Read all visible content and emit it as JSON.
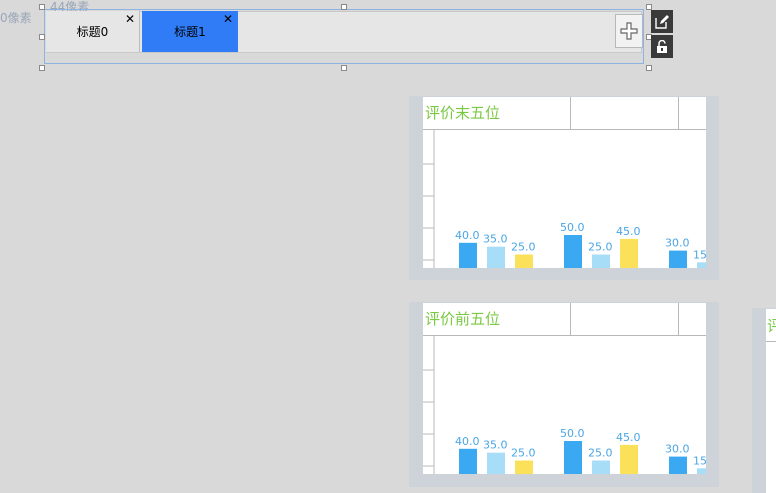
{
  "measure": {
    "left_label": "0像素",
    "top_label": "44像素"
  },
  "tabs": [
    {
      "label": "标题0",
      "close": "✕"
    },
    {
      "label": "标题1",
      "close": "✕"
    }
  ],
  "colors": {
    "bar_blue": "#3aa9f2",
    "bar_lightblue": "#a8ddf8",
    "bar_yellow": "#fbe05a",
    "title_green": "#7ac943"
  },
  "cards": [
    {
      "title": "评价末五位"
    },
    {
      "title": "评价前五位"
    },
    {
      "title": "评"
    }
  ],
  "chart_data": [
    {
      "type": "bar",
      "title": "评价末五位",
      "series": [
        {
          "values": [
            40.0,
            50.0,
            30.0
          ]
        },
        {
          "values": [
            35.0,
            25.0,
            15.0
          ]
        },
        {
          "values": [
            25.0,
            45.0
          ]
        }
      ],
      "labels": [
        "40.0",
        "35.0",
        "25.0",
        "50.0",
        "25.0",
        "45.0",
        "30.0",
        "15"
      ]
    },
    {
      "type": "bar",
      "title": "评价前五位",
      "series": [
        {
          "values": [
            40.0,
            50.0,
            30.0
          ]
        },
        {
          "values": [
            35.0,
            25.0,
            15.0
          ]
        },
        {
          "values": [
            25.0,
            45.0
          ]
        }
      ],
      "labels": [
        "40.0",
        "35.0",
        "25.0",
        "50.0",
        "25.0",
        "45.0",
        "30.0",
        "15"
      ]
    }
  ]
}
